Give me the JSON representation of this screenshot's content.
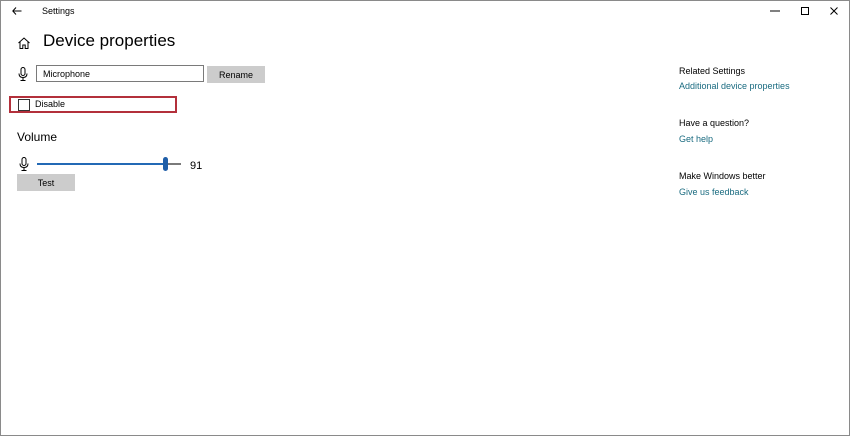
{
  "window": {
    "title": "Settings"
  },
  "header": {
    "title": "Device properties"
  },
  "device": {
    "name_value": "Microphone",
    "rename_label": "Rename",
    "disable_label": "Disable",
    "disable_checked": false
  },
  "volume": {
    "heading": "Volume",
    "value": 91,
    "value_text": "91",
    "test_label": "Test"
  },
  "side": {
    "related_heading": "Related Settings",
    "related_link": "Additional device properties",
    "question_heading": "Have a question?",
    "help_link": "Get help",
    "better_heading": "Make Windows better",
    "feedback_link": "Give us feedback"
  },
  "colors": {
    "accent": "#1f5ea8",
    "link": "#1a6b80",
    "highlight": "#b3303b",
    "button_bg": "#cccccc"
  },
  "icons": {
    "back": "back-arrow-icon",
    "home": "home-icon",
    "microphone": "microphone-icon",
    "minimize": "minimize-icon",
    "maximize": "maximize-icon",
    "close": "close-icon"
  }
}
